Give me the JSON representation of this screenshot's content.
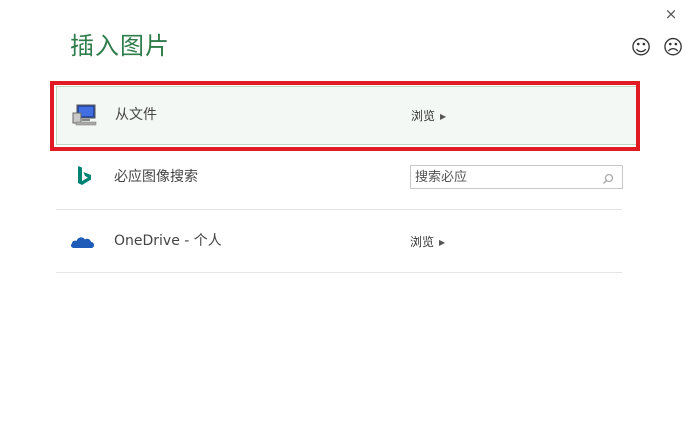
{
  "dialog": {
    "title": "插入图片",
    "close_glyph": "×",
    "smile_glyph": "☺",
    "frown_glyph": "☹"
  },
  "sources": [
    {
      "label": "从文件",
      "action": "浏览",
      "icon": "computer-icon"
    },
    {
      "label": "必应图像搜索",
      "search_placeholder": "搜索必应",
      "icon": "bing-icon"
    },
    {
      "label": "OneDrive - 个人",
      "action": "浏览",
      "icon": "onedrive-cloud-icon"
    }
  ],
  "colors": {
    "title": "#2e7d4a",
    "highlight_border": "#e01b24",
    "bing": "#008373",
    "onedrive": "#1e5bb8"
  }
}
